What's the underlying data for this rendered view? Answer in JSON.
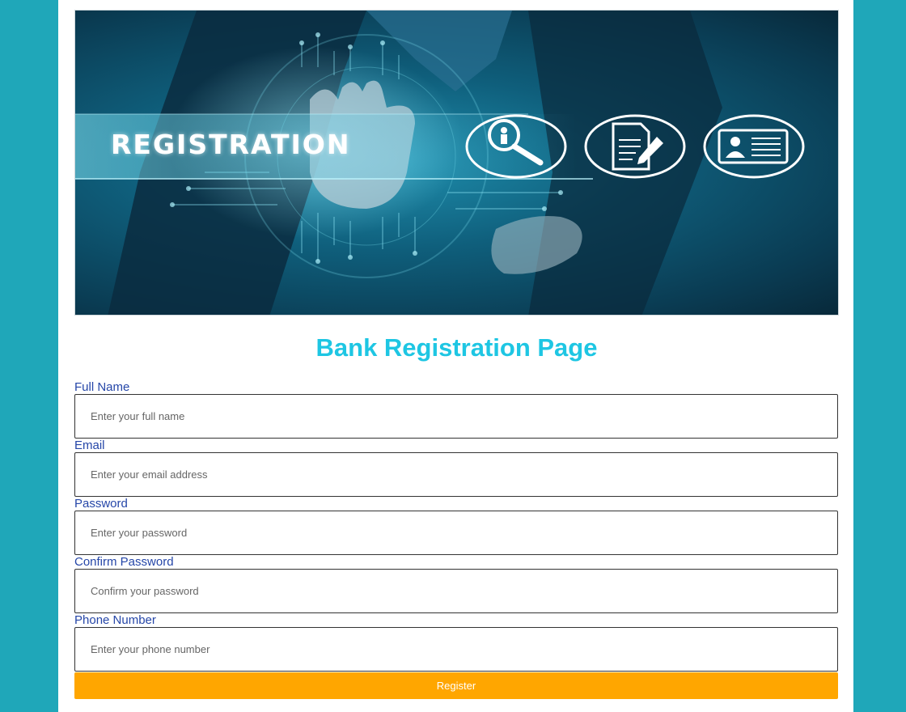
{
  "hero": {
    "banner_text": "REGISTRATION",
    "icons": [
      "search-person-icon",
      "document-edit-icon",
      "id-card-icon"
    ]
  },
  "page_title": "Bank Registration Page",
  "form": {
    "fields": [
      {
        "label": "Full Name",
        "placeholder": "Enter your full name",
        "type": "text"
      },
      {
        "label": "Email",
        "placeholder": "Enter your email address",
        "type": "email"
      },
      {
        "label": "Password",
        "placeholder": "Enter your password",
        "type": "password"
      },
      {
        "label": "Confirm Password",
        "placeholder": "Confirm your password",
        "type": "password"
      },
      {
        "label": "Phone Number",
        "placeholder": "Enter your phone number",
        "type": "tel"
      }
    ],
    "submit_label": "Register"
  },
  "colors": {
    "background": "#1fa7b9",
    "title": "#1ec6e3",
    "label": "#2546a8",
    "button": "#ffa600"
  }
}
